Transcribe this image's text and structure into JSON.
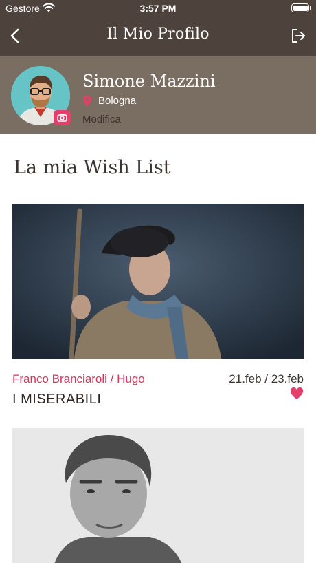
{
  "status_bar": {
    "carrier": "Gestore",
    "time": "3:57 PM"
  },
  "nav": {
    "title": "Il Mio Profilo",
    "back_icon": "chevron-left-icon",
    "logout_icon": "logout-icon"
  },
  "profile": {
    "name": "Simone Mazzini",
    "city": "Bologna",
    "edit_label": "Modifica",
    "colors": {
      "band": "#7a6d62",
      "badge": "#e23f6a"
    }
  },
  "wishlist": {
    "title": "La mia Wish List",
    "items": [
      {
        "artist": "Franco Branciaroli / Hugo",
        "dates": "21.feb / 23.feb",
        "title": "I MISERABILI",
        "favorite": true
      }
    ]
  },
  "theme": {
    "header_bg": "#4e433c",
    "accent": "#d9355a",
    "text": "#3b3330"
  }
}
